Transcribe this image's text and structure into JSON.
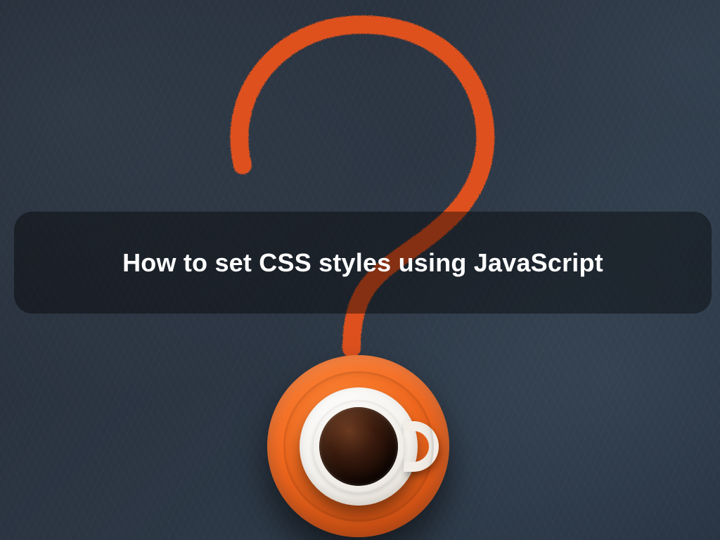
{
  "title": "How to set CSS styles using JavaScript",
  "graphic": {
    "symbol": "question-mark",
    "chalk_color": "#e8521f",
    "object": "coffee-cup-on-saucer",
    "saucer_color": "#f46a1f",
    "cup_color": "#ffffff"
  }
}
